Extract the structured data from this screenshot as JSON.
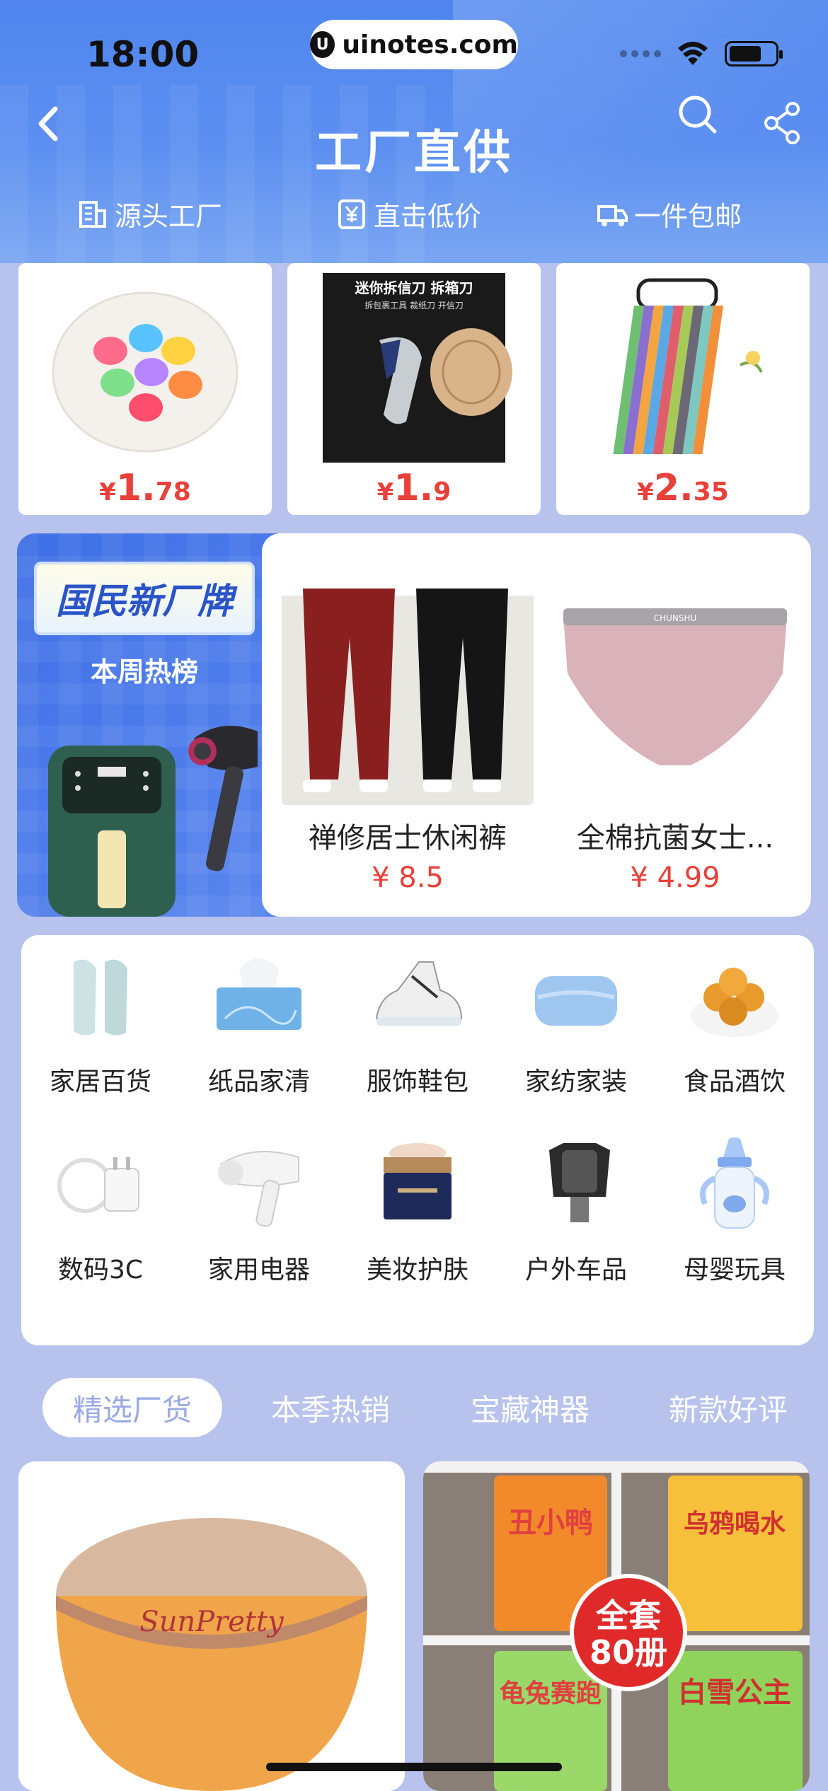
{
  "status_bar": {
    "time": "18:00",
    "url": "uinotes.com"
  },
  "header": {
    "title": "工厂直供",
    "features": [
      "源头工厂",
      "直击低价",
      "一件包邮"
    ]
  },
  "top_products": [
    {
      "currency": "¥",
      "int": "1.",
      "dec": "78"
    },
    {
      "currency": "¥",
      "int": "1.",
      "dec": "9",
      "image_title": "迷你拆信刀 拆箱刀",
      "image_sub": "拆包裹工具 裁纸刀 开信刀"
    },
    {
      "currency": "¥",
      "int": "2.",
      "dec": "35"
    }
  ],
  "brand": {
    "badge": "国民新厂牌",
    "subtitle": "本周热榜",
    "items": [
      {
        "name": "禅修居士休闲裤",
        "price": "¥ 8.5"
      },
      {
        "name": "全棉抗菌女士...",
        "price": "¥ 4.99",
        "image_brand": "CHUNSHU"
      }
    ]
  },
  "categories": [
    {
      "label": "家居百货",
      "icon": "slippers-icon"
    },
    {
      "label": "纸品家清",
      "icon": "tissue-box-icon"
    },
    {
      "label": "服饰鞋包",
      "icon": "sneaker-icon"
    },
    {
      "label": "家纺家装",
      "icon": "towel-icon"
    },
    {
      "label": "食品酒饮",
      "icon": "cake-icon"
    },
    {
      "label": "数码3C",
      "icon": "charger-icon"
    },
    {
      "label": "家用电器",
      "icon": "hair-dryer-icon"
    },
    {
      "label": "美妆护肤",
      "icon": "cream-jar-icon"
    },
    {
      "label": "户外车品",
      "icon": "phone-holder-icon"
    },
    {
      "label": "母婴玩具",
      "icon": "baby-bottle-icon"
    }
  ],
  "tabs": [
    "精选厂货",
    "本季热销",
    "宝藏神器",
    "新款好评"
  ],
  "bottom_products": [
    {
      "brand_text": "SunPretty"
    },
    {
      "badge": "全套\n80册",
      "book_titles": [
        "丑小鸭",
        "乌鸦喝水",
        "龟兔赛跑",
        "白雪公主"
      ]
    }
  ],
  "colors": {
    "accent_blue": "#4f86ee",
    "price_red": "#e8403a",
    "page_bg": "#b7c3ec"
  }
}
